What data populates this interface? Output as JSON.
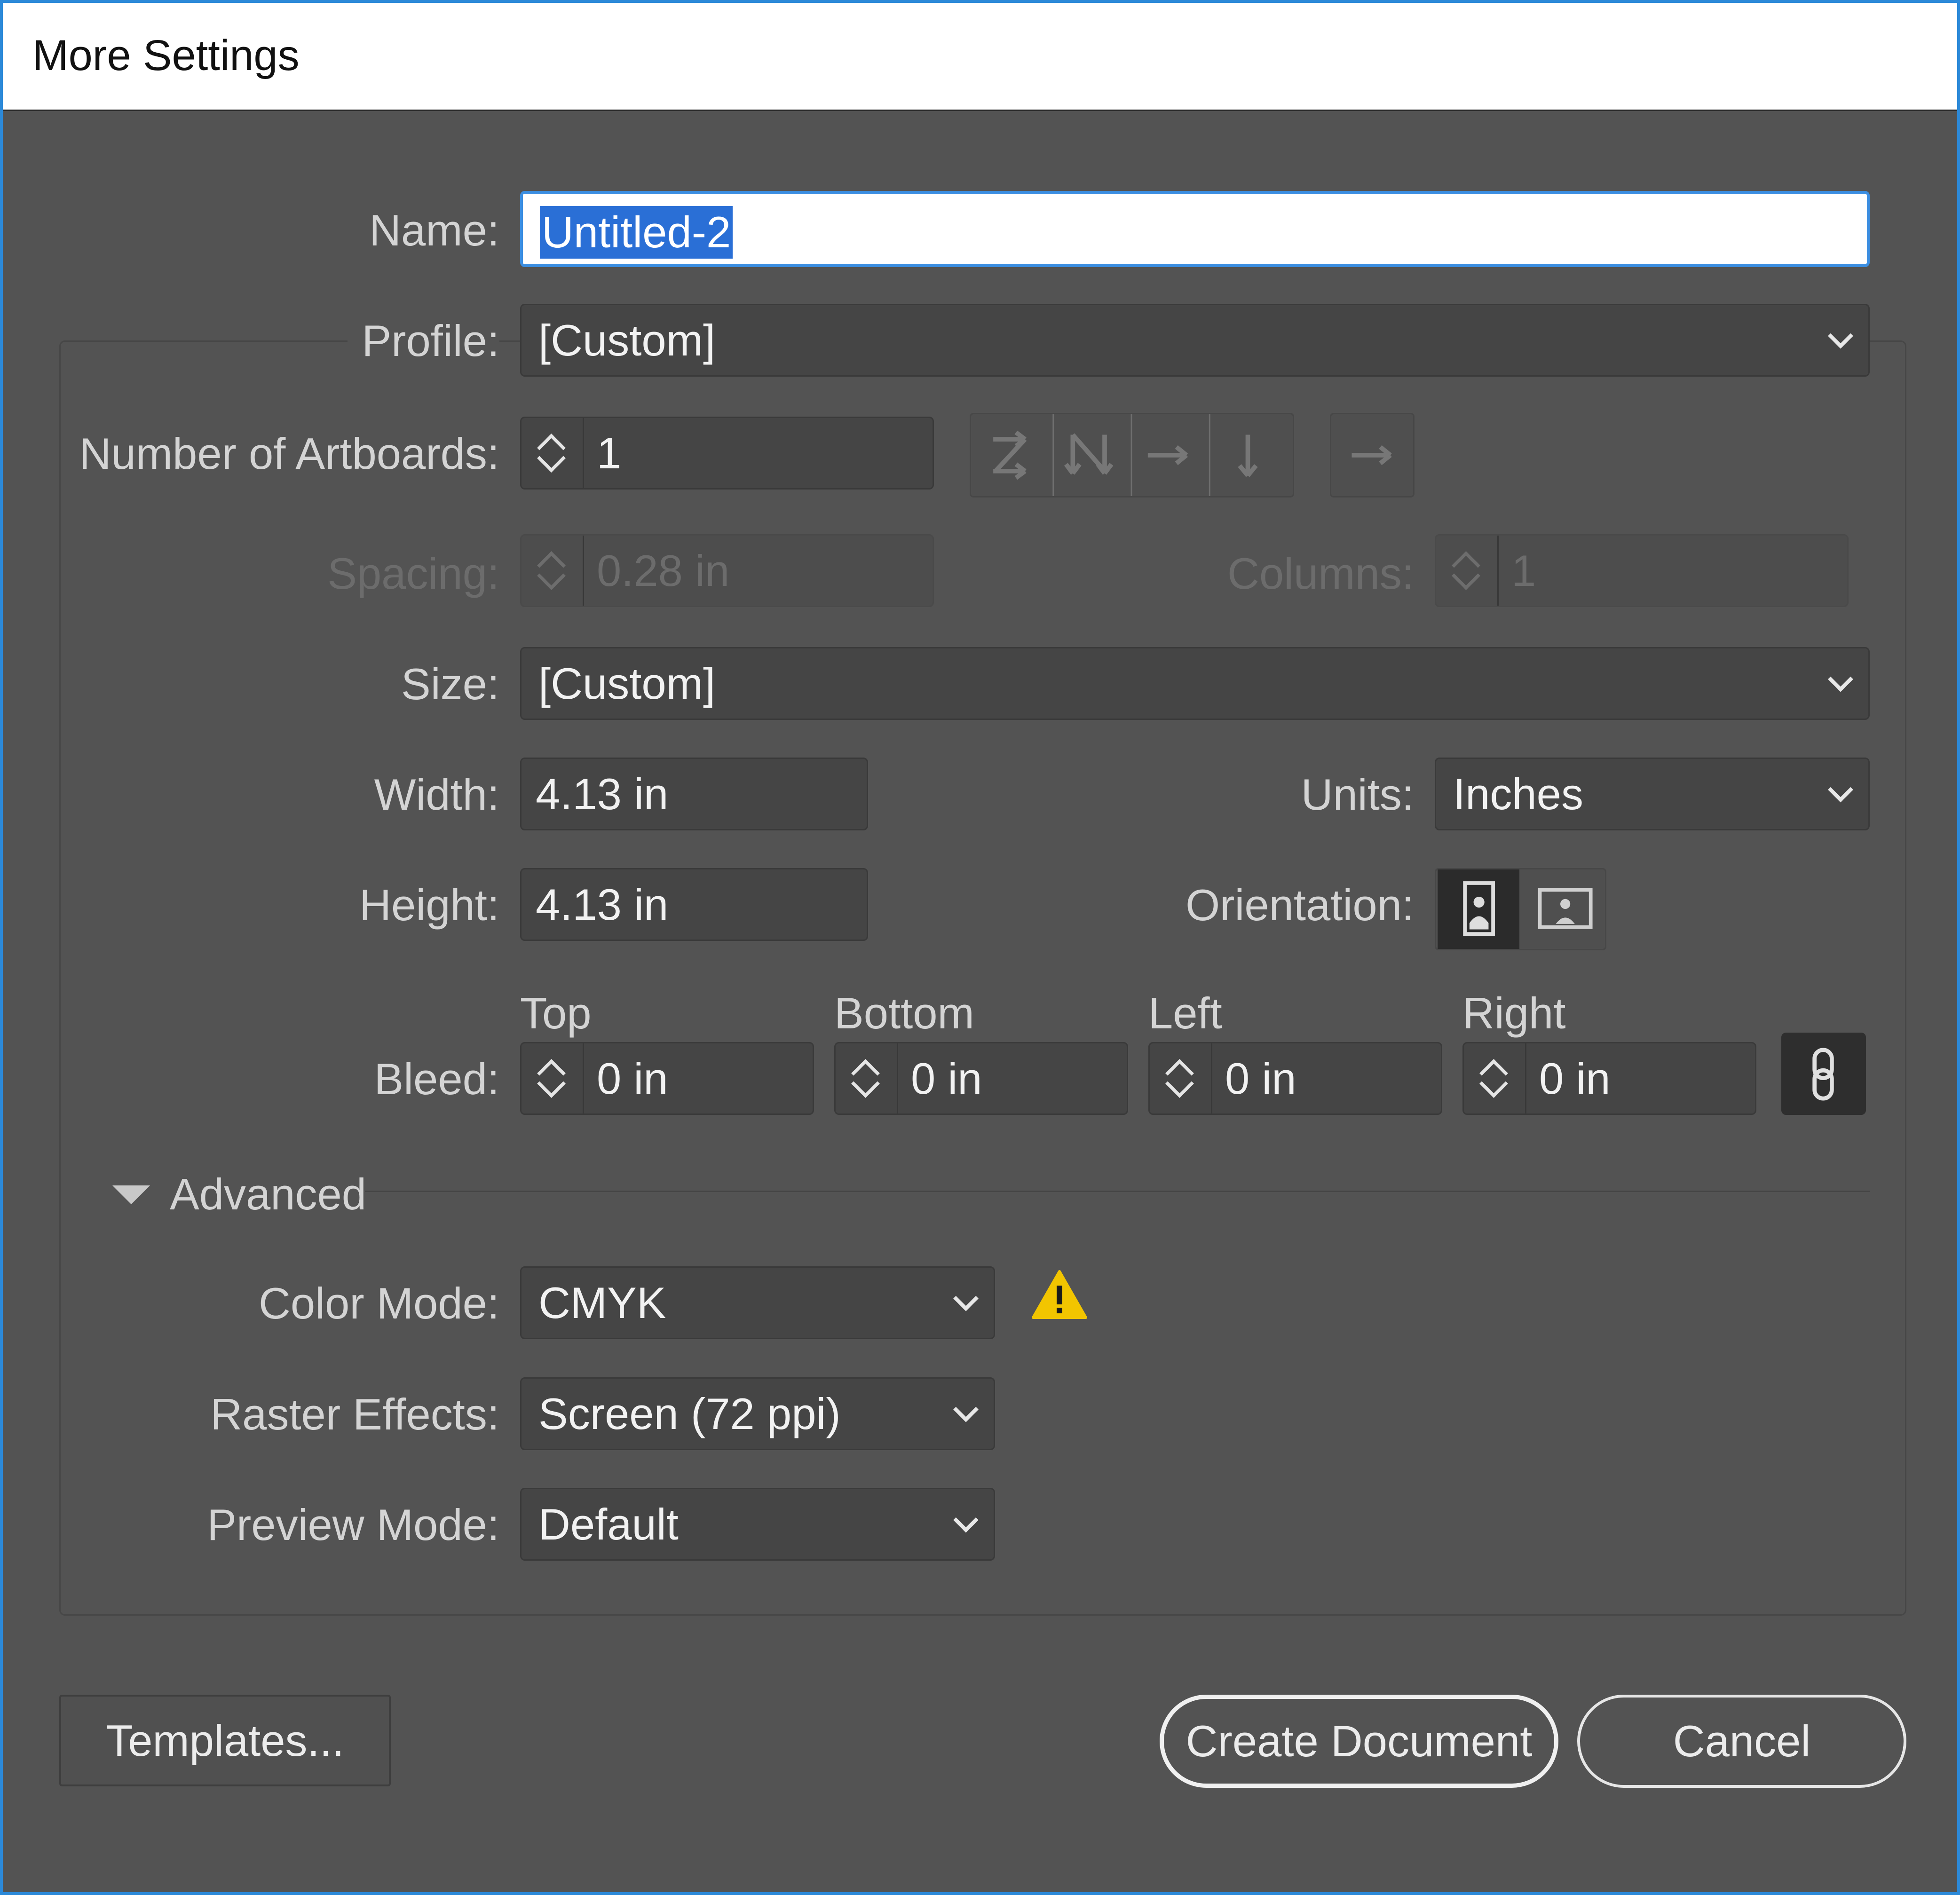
{
  "dialog": {
    "title": "More Settings"
  },
  "form": {
    "name": {
      "label": "Name:",
      "value": "Untitled-2"
    },
    "profile": {
      "label": "Profile:",
      "value": "[Custom]"
    },
    "artboards": {
      "label": "Number of Artboards:",
      "value": "1",
      "layout_icons": [
        "grid-by-row-icon",
        "grid-by-column-icon",
        "arrange-by-row-icon",
        "arrange-by-column-icon",
        "change-to-right-to-left-icon"
      ]
    },
    "spacing": {
      "label": "Spacing:",
      "value": "0.28 in"
    },
    "columns": {
      "label": "Columns:",
      "value": "1"
    },
    "size": {
      "label": "Size:",
      "value": "[Custom]"
    },
    "width": {
      "label": "Width:",
      "value": "4.13 in"
    },
    "units": {
      "label": "Units:",
      "value": "Inches"
    },
    "height": {
      "label": "Height:",
      "value": "4.13 in"
    },
    "orientation": {
      "label": "Orientation:",
      "selected": "portrait"
    },
    "bleed": {
      "label": "Bleed:",
      "top": {
        "label": "Top",
        "value": "0 in"
      },
      "bottom": {
        "label": "Bottom",
        "value": "0 in"
      },
      "left": {
        "label": "Left",
        "value": "0 in"
      },
      "right": {
        "label": "Right",
        "value": "0 in"
      }
    },
    "advanced": {
      "label": "Advanced",
      "color_mode": {
        "label": "Color Mode:",
        "value": "CMYK"
      },
      "raster_effects": {
        "label": "Raster Effects:",
        "value": "Screen (72 ppi)"
      },
      "preview_mode": {
        "label": "Preview Mode:",
        "value": "Default"
      }
    }
  },
  "buttons": {
    "templates": "Templates...",
    "create": "Create Document",
    "cancel": "Cancel"
  },
  "colors": {
    "background": "#535353",
    "field": "#454545",
    "selection": "#2a6fd6",
    "warning": "#f2c500"
  }
}
